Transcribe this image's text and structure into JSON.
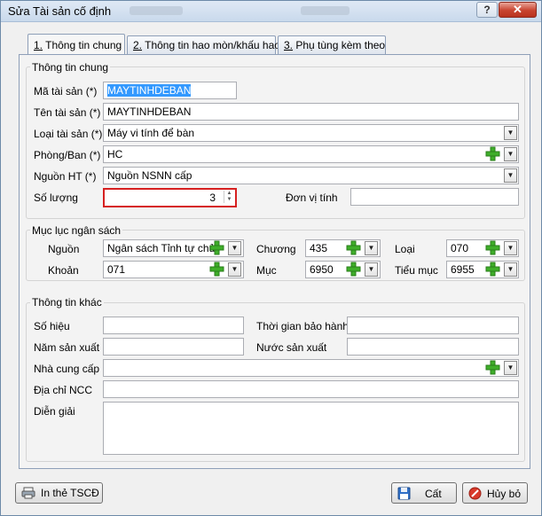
{
  "window": {
    "title": "Sửa Tài sản cố định",
    "help": "?",
    "close": "✕"
  },
  "tabs": [
    {
      "key": "1.",
      "label": " Thông tin chung"
    },
    {
      "key": "2.",
      "label": " Thông tin hao mòn/khấu hao"
    },
    {
      "key": "3.",
      "label": " Phụ tùng kèm theo"
    }
  ],
  "general": {
    "title": "Thông tin chung",
    "asset_code_label": "Mã tài sản (*)",
    "asset_code": "MAYTINHDEBAN",
    "asset_name_label": "Tên tài sản (*)",
    "asset_name": "MAYTINHDEBAN",
    "asset_type_label": "Loại tài sản (*)",
    "asset_type": "Máy vi tính để bàn",
    "department_label": "Phòng/Ban (*)",
    "department": "HC",
    "source_label": "Nguồn HT (*)",
    "source": "Nguồn NSNN cấp",
    "quantity_label": "Số lượng",
    "quantity": "3",
    "unit_label": "Đơn vị tính",
    "unit": ""
  },
  "budget": {
    "title": "Mục lục ngân sách",
    "source_label": "Nguồn",
    "source": "Ngân sách Tỉnh tự chủ",
    "chapter_label": "Chương",
    "chapter": "435",
    "type_label": "Loại",
    "type": "070",
    "item_label": "Khoản",
    "item": "071",
    "section_label": "Mục",
    "section": "6950",
    "subsection_label": "Tiểu mục",
    "subsection": "6955"
  },
  "other": {
    "title": "Thông tin khác",
    "serial_label": "Số hiệu",
    "serial": "",
    "warranty_label": "Thời gian bảo hành",
    "warranty": "",
    "year_label": "Năm sản xuất",
    "year": "",
    "country_label": "Nước sản xuất",
    "country": "",
    "supplier_label": "Nhà cung cấp",
    "supplier": "",
    "supplier_addr_label": "Địa chỉ NCC",
    "supplier_addr": "",
    "notes_label": "Diễn giải",
    "notes": ""
  },
  "buttons": {
    "print": "In thẻ TSCĐ",
    "save": "Cất",
    "cancel": "Hủy bỏ"
  },
  "colors": {
    "accent": "#3399ff",
    "highlight_border": "#d62020",
    "plus_green": "#3fae2a"
  },
  "icons": {
    "plus": "plus-icon",
    "dropdown": "chevron-down-icon",
    "print": "print-icon",
    "save": "floppy-icon",
    "cancel": "cancel-icon"
  }
}
